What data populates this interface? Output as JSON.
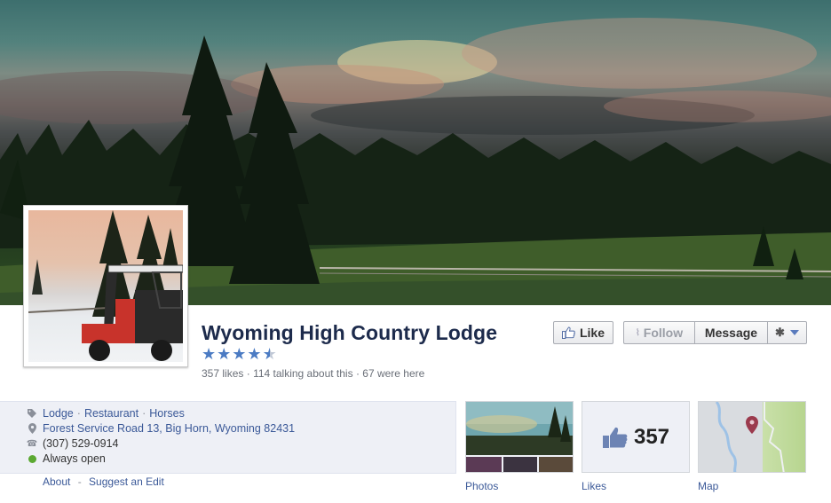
{
  "page": {
    "name": "Wyoming High Country Lodge",
    "rating_stars": 4.5,
    "stats_likes": "357 likes",
    "stats_sep1": "·",
    "stats_talking": "114 talking about this",
    "stats_sep2": "·",
    "stats_were_here": "67 were here"
  },
  "actions": {
    "like_label": "Like",
    "follow_label": "Follow",
    "message_label": "Message"
  },
  "info": {
    "categories": [
      "Lodge",
      "Restaurant",
      "Horses"
    ],
    "category_sep": "·",
    "address": "Forest Service Road 13, Big Horn, Wyoming 82431",
    "phone": "(307) 529-0914",
    "hours": "Always open"
  },
  "footer_links": {
    "about": "About",
    "dash": "-",
    "suggest": "Suggest an Edit"
  },
  "apps": {
    "photos_label": "Photos",
    "likes_label": "Likes",
    "likes_count": "357",
    "map_label": "Map"
  },
  "colors": {
    "link": "#3b5998",
    "name": "#1d2b4c",
    "star": "#4b7bc3",
    "open_status": "#5ba932"
  },
  "icons": {
    "category": "tag-icon",
    "address": "map-pin-icon",
    "phone": "phone-icon",
    "hours": "status-dot-icon"
  }
}
